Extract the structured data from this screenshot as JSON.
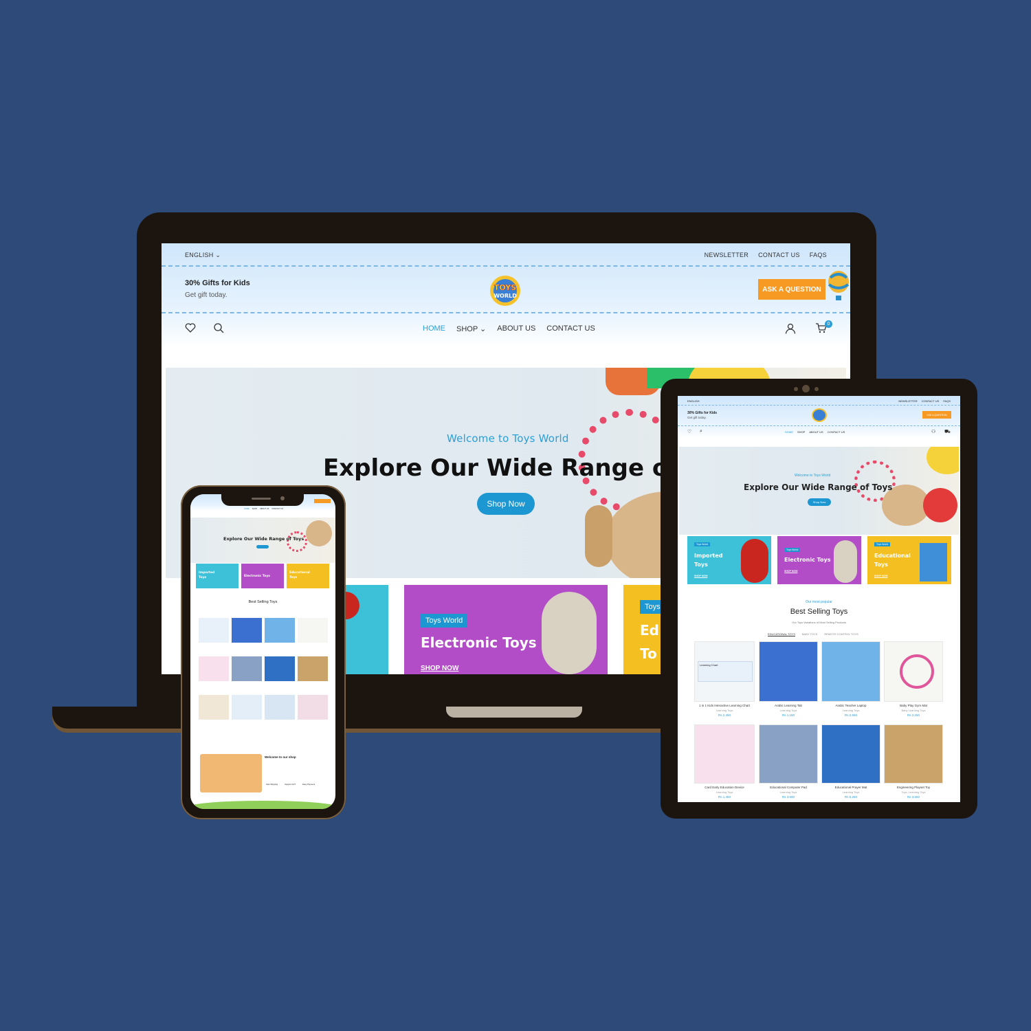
{
  "colors": {
    "background": "#2e4a78",
    "accent": "#1d97d2",
    "ask": "#f79a24",
    "device": "#1c150f"
  },
  "site": {
    "language": "ENGLISH",
    "top_links": [
      "NEWSLETTER",
      "CONTACT US",
      "FAQS"
    ],
    "promo_title": "30% Gifts for Kids",
    "promo_sub": "Get gift today.",
    "logo_top": "TOYS",
    "logo_bottom": "WORLD",
    "ask_button": "ASK A QUESTION",
    "nav": [
      "HOME",
      "SHOP",
      "ABOUT US",
      "CONTACT US"
    ],
    "cart_count": "0",
    "hero_welcome": "Welcome to Toys World",
    "hero_title": "Explore Our Wide Range of Toys",
    "hero_button": "Shop Now",
    "categories": [
      {
        "tag": "Toys World",
        "name": "Imported Toys",
        "shop": "SHOP NOW"
      },
      {
        "tag": "Toys World",
        "name": "Electronic Toys",
        "shop": "SHOP NOW"
      },
      {
        "tag": "Toys World",
        "name": "Educational Toys",
        "shop": "SHOP NOW"
      }
    ],
    "laptop_cat_partial_name": "Ed",
    "laptop_cat_partial_name2": "To",
    "laptop_cat_partial_tag": "Toys",
    "popular_sub": "Our most popular",
    "best_title": "Best Selling Toys",
    "best_desc": "Our Toys Variations of Most Selling Products",
    "product_tabs": [
      "EDUCATIONAL TOYS",
      "BABY TOYS",
      "REMOTE CONTROL TOYS"
    ],
    "products": [
      {
        "name": "1 in 1 Kids Interactive Learning Chart",
        "cat": "Learning Toys",
        "price": "Rs 2,450"
      },
      {
        "name": "Arabic Learning Tab",
        "cat": "Learning Toys",
        "price": "Rs 1,150"
      },
      {
        "name": "Arabic Teacher Laptop",
        "cat": "Learning Toys",
        "price": "Rs 2,550"
      },
      {
        "name": "Baby Play Gym Mat",
        "cat": "Baby Learning Toys",
        "price": "Rs 2,250"
      },
      {
        "name": "Card Early Education Device",
        "cat": "Learning Toys",
        "price": "Rs 1,450"
      },
      {
        "name": "Educational Computer Pad",
        "cat": "Learning Toys",
        "price": "Rs 3,650"
      },
      {
        "name": "Educational Prayer Mat",
        "cat": "Learning Toys",
        "price": "Rs 5,250"
      },
      {
        "name": "Engineering Playset Toy",
        "cat": "Toys, Learning Toys",
        "price": "Rs 3,650"
      }
    ],
    "chart_label": "Learning Chart",
    "welcome_shop": "Welcome to our shop",
    "features": [
      "Fast Shipping",
      "Support 24/7",
      "Easy Payment"
    ]
  }
}
